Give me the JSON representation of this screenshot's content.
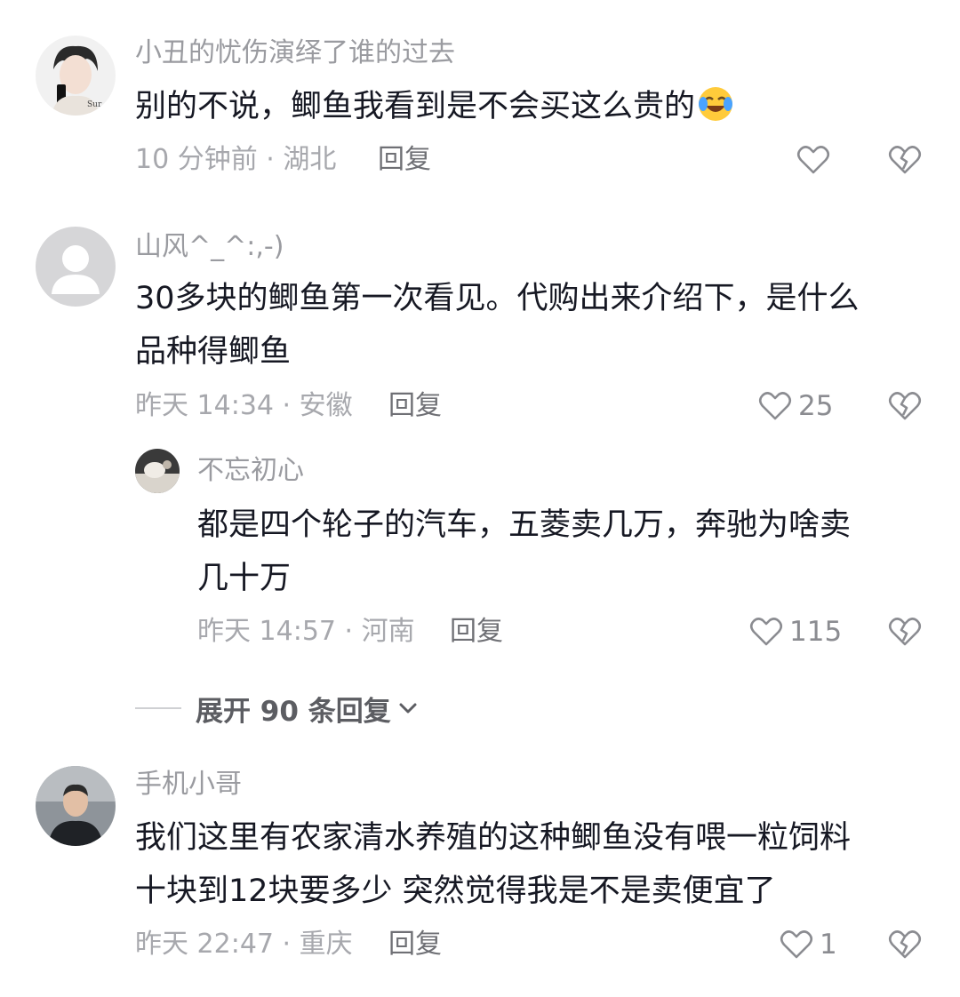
{
  "comments": [
    {
      "username": "小丑的忧伤演绎了谁的过去",
      "text_lines": [
        "别的不说，鲫鱼我看到是不会买这么贵的"
      ],
      "emoji": "laughing-tears-emoji",
      "meta": "10 分钟前 · 湖北",
      "reply_label": "回复",
      "like_count": ""
    },
    {
      "username": "山风^_^:,-)",
      "text_lines": [
        "30多块的鲫鱼第一次看见。代购出来介绍下，是什么",
        "品种得鲫鱼"
      ],
      "meta": "昨天 14:34 · 安徽",
      "reply_label": "回复",
      "like_count": "25"
    },
    {
      "username": "不忘初心",
      "text_lines": [
        "都是四个轮子的汽车，五菱卖几万，奔驰为啥卖",
        "几十万"
      ],
      "meta": "昨天 14:57 · 河南",
      "reply_label": "回复",
      "like_count": "115"
    },
    {
      "username": "手机小哥",
      "text_lines": [
        "我们这里有农家清水养殖的这种鲫鱼没有喂一粒饲料",
        "十块到12块要多少  突然觉得我是不是卖便宜了"
      ],
      "meta": "昨天 22:47 · 重庆",
      "reply_label": "回复",
      "like_count": "1"
    }
  ],
  "expand_replies": {
    "label": "展开 90 条回复"
  },
  "icons": {
    "like": "heart-outline-icon",
    "dislike": "broken-heart-icon",
    "expand": "chevron-down-icon"
  },
  "colors": {
    "username": "#9a9ba0",
    "text": "#161823",
    "meta": "#a7a8ad",
    "icon": "#8b8c91"
  }
}
